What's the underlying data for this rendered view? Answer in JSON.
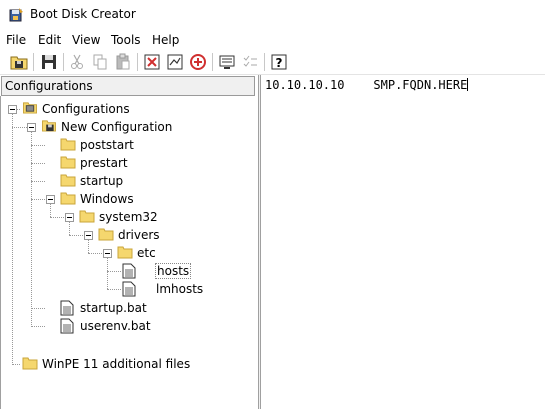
{
  "window": {
    "title": "Boot Disk Creator"
  },
  "menu": {
    "items": [
      "File",
      "Edit",
      "View",
      "Tools",
      "Help"
    ]
  },
  "toolbar": {
    "icons": [
      "new-config-icon",
      "save-icon",
      "cut-icon",
      "copy-icon",
      "paste-icon",
      "add-file-icon",
      "add-folder-icon",
      "delete-icon",
      "preview-icon",
      "properties-icon",
      "help-icon"
    ]
  },
  "left_pane": {
    "header": "Configurations",
    "tree": [
      {
        "label": "Configurations",
        "kind": "root"
      },
      {
        "label": "New Configuration",
        "kind": "config"
      },
      {
        "label": "poststart",
        "kind": "folder"
      },
      {
        "label": "prestart",
        "kind": "folder"
      },
      {
        "label": "startup",
        "kind": "folder"
      },
      {
        "label": "Windows",
        "kind": "folder"
      },
      {
        "label": "system32",
        "kind": "folder"
      },
      {
        "label": "drivers",
        "kind": "folder"
      },
      {
        "label": "etc",
        "kind": "folder"
      },
      {
        "label": "hosts",
        "kind": "file",
        "selected": true
      },
      {
        "label": "lmhosts",
        "kind": "file"
      },
      {
        "label": "startup.bat",
        "kind": "file"
      },
      {
        "label": "userenv.bat",
        "kind": "file"
      },
      {
        "label": "WinPE 11 additional files",
        "kind": "folder"
      }
    ]
  },
  "editor": {
    "ip": "10.10.10.10",
    "host": "SMP.FQDN.HERE"
  },
  "colors": {
    "folder": "#f5d76e",
    "folder_border": "#c9a43a",
    "delete_red": "#d03030"
  }
}
